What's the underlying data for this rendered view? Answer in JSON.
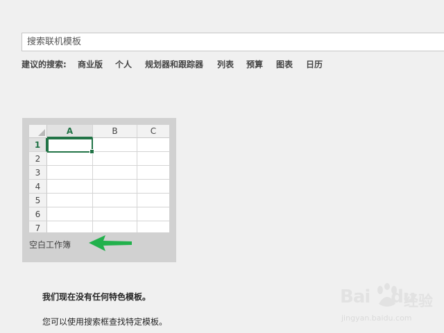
{
  "search": {
    "placeholder": "搜索联机模板"
  },
  "suggestions": {
    "label": "建议的搜索:",
    "items": [
      "商业版",
      "个人",
      "规划器和跟踪器",
      "列表",
      "预算",
      "图表",
      "日历"
    ]
  },
  "template": {
    "name": "空白工作簿",
    "columns": [
      "A",
      "B",
      "C"
    ],
    "rows": [
      "1",
      "2",
      "3",
      "4",
      "5",
      "6",
      "7"
    ]
  },
  "messages": {
    "no_featured": "我们现在没有任何特色模板。",
    "hint": "您可以使用搜索框查找特定模板。"
  },
  "watermark": {
    "brand": "Bai",
    "brand2": "du",
    "cn": "经验",
    "url": "jingyan.baidu.com"
  },
  "colors": {
    "excel_green": "#217346",
    "annotation_arrow": "#22b14c"
  }
}
